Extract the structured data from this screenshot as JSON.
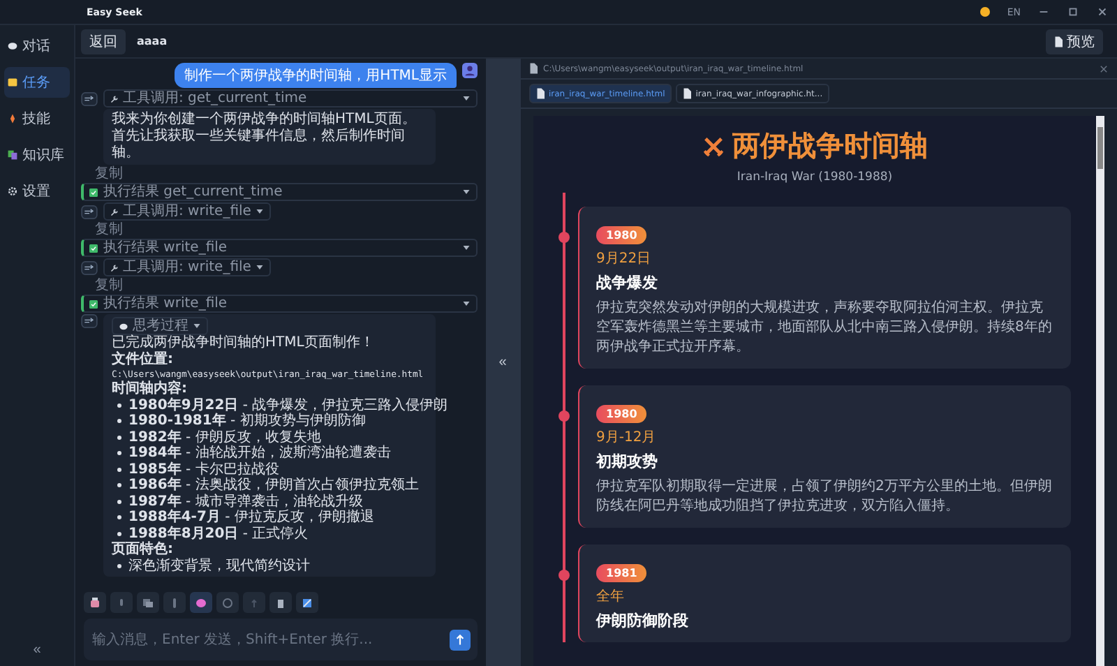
{
  "app": {
    "title": "Easy Seek",
    "language": "EN"
  },
  "sidebar": {
    "items": [
      {
        "kind": "chat",
        "label": "对话",
        "selected": false
      },
      {
        "kind": "task",
        "label": "任务",
        "selected": true
      },
      {
        "kind": "skill",
        "label": "技能",
        "selected": false
      },
      {
        "kind": "knowledge",
        "label": "知识库",
        "selected": false
      },
      {
        "kind": "settings",
        "label": "设置",
        "selected": false
      }
    ],
    "collapse": "«"
  },
  "header": {
    "back": "返回",
    "title": "aaaa",
    "preview": "预览"
  },
  "chat": {
    "entries": [
      {
        "kind": "user",
        "text": "制作一个两伊战争的时间轴，用HTML显示"
      },
      {
        "kind": "tool_call",
        "text": "工具调用: get_current_time"
      },
      {
        "kind": "assistant",
        "text": "我来为你创建一个两伊战争的时间轴HTML页面。首先让我获取一些关键事件信息，然后制作时间轴。"
      },
      {
        "kind": "copy",
        "text": "复制"
      },
      {
        "kind": "tool_result",
        "text": "执行结果 get_current_time"
      },
      {
        "kind": "tool_call",
        "text": "工具调用: write_file"
      },
      {
        "kind": "copy",
        "text": "复制"
      },
      {
        "kind": "tool_result",
        "text": "执行结果 write_file"
      },
      {
        "kind": "tool_call",
        "text": "工具调用: write_file"
      },
      {
        "kind": "copy",
        "text": "复制"
      },
      {
        "kind": "tool_result",
        "text": "执行结果 write_file"
      }
    ],
    "final": {
      "thinking": "思考过程",
      "lines": [
        {
          "kind": "p",
          "text": "已完成两伊战争时间轴的HTML页面制作！"
        },
        {
          "kind": "h",
          "text": "文件位置:"
        },
        {
          "kind": "code",
          "text": "C:\\Users\\wangm\\easyseek\\output\\iran_iraq_war_timeline.html"
        },
        {
          "kind": "h",
          "text": "时间轴内容:"
        },
        {
          "kind": "li",
          "text": "**1980年9月22日** - 战争爆发，伊拉克三路入侵伊朗"
        },
        {
          "kind": "li",
          "text": "**1980-1981年** - 初期攻势与伊朗防御"
        },
        {
          "kind": "li",
          "text": "**1982年** - 伊朗反攻，收复失地"
        },
        {
          "kind": "li",
          "text": "**1984年** - 油轮战开始，波斯湾油轮遭袭击"
        },
        {
          "kind": "li",
          "text": "**1985年** - 卡尔巴拉战役"
        },
        {
          "kind": "li",
          "text": "**1986年** - 法奥战役，伊朗首次占领伊拉克领土"
        },
        {
          "kind": "li",
          "text": "**1987年** - 城市导弹袭击，油轮战升级"
        },
        {
          "kind": "li",
          "text": "**1988年4-7月** - 伊拉克反攻，伊朗撤退"
        },
        {
          "kind": "li",
          "text": "**1988年8月20日** - 正式停火"
        },
        {
          "kind": "h",
          "text": "页面特色:"
        },
        {
          "kind": "li",
          "text": "深色渐变背景，现代简约设计"
        }
      ]
    }
  },
  "toggle": "«",
  "composer": {
    "placeholder": "输入消息，Enter 发送，Shift+Enter 换行..."
  },
  "preview": {
    "path": "C:\\Users\\wangm\\easyseek\\output\\iran_iraq_war_timeline.html",
    "tabs": [
      {
        "label": "iran_iraq_war_timeline.html",
        "selected": true
      },
      {
        "label": "iran_iraq_war_infographic.ht...",
        "selected": false
      }
    ],
    "page": {
      "title": "两伊战争时间轴",
      "subtitle": "Iran-Iraq War (1980-1988)",
      "events": [
        {
          "year": "1980",
          "date": "9月22日",
          "title": "战争爆发",
          "description": "伊拉克突然发动对伊朗的大规模进攻，声称要夺取阿拉伯河主权。伊拉克空军轰炸德黑兰等主要城市，地面部队从北中南三路入侵伊朗。持续8年的两伊战争正式拉开序幕。"
        },
        {
          "year": "1980",
          "date": "9月-12月",
          "title": "初期攻势",
          "description": "伊拉克军队初期取得一定进展，占领了伊朗约2万平方公里的土地。但伊朗防线在阿巴丹等地成功阻挡了伊拉克进攻，双方陷入僵持。"
        },
        {
          "year": "1981",
          "date": "全年",
          "title": "伊朗防御阶段"
        }
      ]
    }
  }
}
